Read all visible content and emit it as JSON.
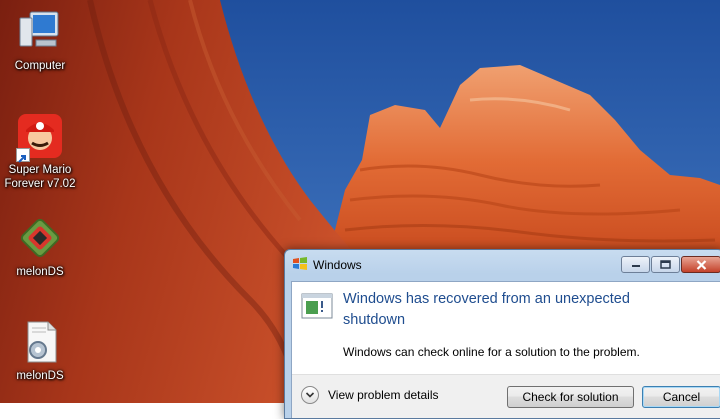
{
  "desktop": {
    "icons": [
      {
        "label": "Computer",
        "icon": "computer-icon"
      },
      {
        "label": "Super Mario\nForever v7.02",
        "icon": "super-mario-icon"
      },
      {
        "label": "melonDS",
        "icon": "melonds-icon"
      },
      {
        "label": "melonDS",
        "icon": "config-file-icon"
      }
    ]
  },
  "dialog": {
    "title": "Windows",
    "heading": "Windows has recovered from an unexpected shutdown",
    "message": "Windows can check online for a solution to the problem.",
    "details_label": "View problem details",
    "primary_button": "Check for solution",
    "cancel_button": "Cancel",
    "icons": {
      "title": "windows-flag-icon",
      "main": "windows-error-report-icon",
      "minimize": "minimize-icon",
      "maximize": "maximize-icon",
      "close": "close-icon",
      "details": "chevron-down-icon"
    }
  },
  "colors": {
    "heading": "#1f4d8f",
    "sky": "#3566b5",
    "rock": "#c64a1f"
  }
}
